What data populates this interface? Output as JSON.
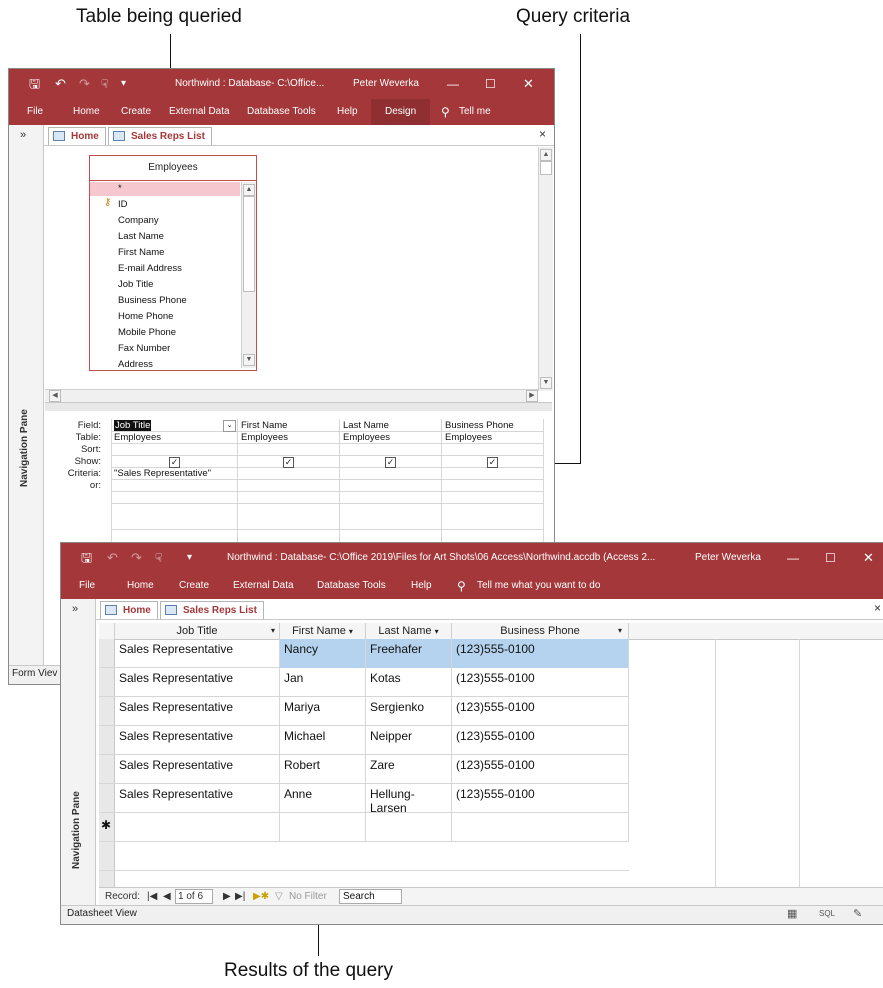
{
  "callouts": {
    "table_being_queried": "Table being queried",
    "query_criteria": "Query criteria",
    "results_of_query": "Results of the query"
  },
  "design_window": {
    "title": "Northwind : Database- C:\\Office...",
    "user": "Peter Weverka",
    "ribbon_tabs": [
      "File",
      "Home",
      "Create",
      "External Data",
      "Database Tools",
      "Help",
      "Design",
      "Tell me"
    ],
    "nav_collapse": "»",
    "nav_pane": "Navigation Pane",
    "doc_tabs": [
      "Home",
      "Sales Reps List"
    ],
    "close": "×",
    "table_name": "Employees",
    "fields": [
      "*",
      "ID",
      "Company",
      "Last Name",
      "First Name",
      "E-mail Address",
      "Job Title",
      "Business Phone",
      "Home Phone",
      "Mobile Phone",
      "Fax Number",
      "Address"
    ],
    "qbe_labels": [
      "Field:",
      "Table:",
      "Sort:",
      "Show:",
      "Criteria:",
      "or:"
    ],
    "qbe_columns": [
      {
        "field": "Job Title",
        "table": "Employees",
        "show": true,
        "criteria": "\"Sales Representative\""
      },
      {
        "field": "First Name",
        "table": "Employees",
        "show": true,
        "criteria": ""
      },
      {
        "field": "Last Name",
        "table": "Employees",
        "show": true,
        "criteria": ""
      },
      {
        "field": "Business Phone",
        "table": "Employees",
        "show": true,
        "criteria": ""
      }
    ],
    "status": "Form Viev"
  },
  "datasheet_window": {
    "title": "Northwind : Database- C:\\Office 2019\\Files for Art Shots\\06 Access\\Northwind.accdb (Access 2...",
    "user": "Peter Weverka",
    "ribbon_tabs": [
      "File",
      "Home",
      "Create",
      "External Data",
      "Database Tools",
      "Help",
      "Tell me what you want to do"
    ],
    "nav_collapse": "»",
    "nav_pane": "Navigation Pane",
    "doc_tabs": [
      "Home",
      "Sales Reps List"
    ],
    "close": "×",
    "columns": [
      "Job Title",
      "First Name",
      "Last Name",
      "Business Phone"
    ],
    "rows": [
      [
        "Sales Representative",
        "Nancy",
        "Freehafer",
        "(123)555-0100"
      ],
      [
        "Sales Representative",
        "Jan",
        "Kotas",
        "(123)555-0100"
      ],
      [
        "Sales Representative",
        "Mariya",
        "Sergienko",
        "(123)555-0100"
      ],
      [
        "Sales Representative",
        "Michael",
        "Neipper",
        "(123)555-0100"
      ],
      [
        "Sales Representative",
        "Robert",
        "Zare",
        "(123)555-0100"
      ],
      [
        "Sales Representative",
        "Anne",
        "Hellung-Larsen",
        "(123)555-0100"
      ]
    ],
    "new_row_marker": "✱",
    "record_nav": {
      "label": "Record:",
      "position": "1 of 6",
      "filter": "No Filter",
      "search": "Search"
    },
    "status": "Datasheet View",
    "view_sql": "SQL"
  },
  "colors": {
    "access_red": "#a4373a",
    "selection": "#b5d3ee"
  }
}
